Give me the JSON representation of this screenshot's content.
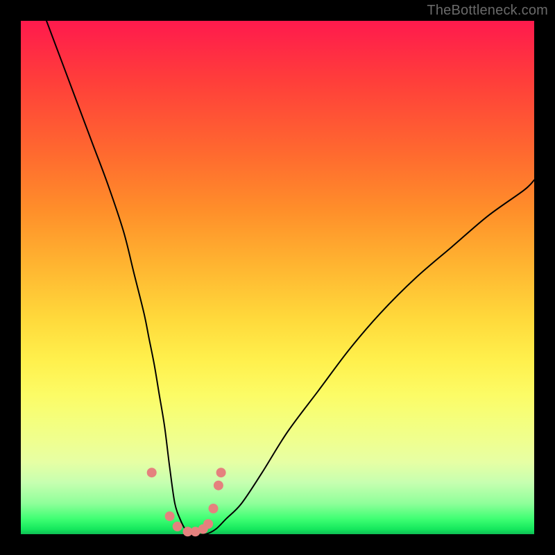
{
  "watermark": "TheBottleneck.com",
  "colors": {
    "background": "#000000",
    "gradient_top": "#ff1a4d",
    "gradient_bottom": "#0fbf55",
    "curve": "#000000",
    "marker": "#e5817e"
  },
  "chart_data": {
    "type": "line",
    "title": "",
    "xlabel": "",
    "ylabel": "",
    "xlim": [
      0,
      100
    ],
    "ylim": [
      0,
      100
    ],
    "grid": false,
    "legend": false,
    "series": [
      {
        "name": "curve",
        "x": [
          5,
          8,
          11,
          14,
          17,
          20,
          22,
          24,
          25,
          26,
          27,
          28,
          29,
          30,
          31,
          32,
          33,
          34,
          36,
          38,
          40,
          43,
          47,
          52,
          58,
          64,
          70,
          77,
          84,
          91,
          98,
          100
        ],
        "values": [
          100,
          92,
          84,
          76,
          68,
          59,
          51,
          43,
          38,
          33,
          27,
          21,
          13,
          6,
          3,
          1,
          0,
          0,
          0,
          1,
          3,
          6,
          12,
          20,
          28,
          36,
          43,
          50,
          56,
          62,
          67,
          69
        ]
      }
    ],
    "markers": [
      {
        "x": 25.5,
        "y": 12
      },
      {
        "x": 29.0,
        "y": 3.5
      },
      {
        "x": 30.5,
        "y": 1.5
      },
      {
        "x": 32.5,
        "y": 0.5
      },
      {
        "x": 34.0,
        "y": 0.5
      },
      {
        "x": 35.5,
        "y": 1.0
      },
      {
        "x": 36.5,
        "y": 2.0
      },
      {
        "x": 37.5,
        "y": 5.0
      },
      {
        "x": 38.5,
        "y": 9.5
      },
      {
        "x": 39.0,
        "y": 12.0
      }
    ],
    "marker_radius_px": 7
  }
}
